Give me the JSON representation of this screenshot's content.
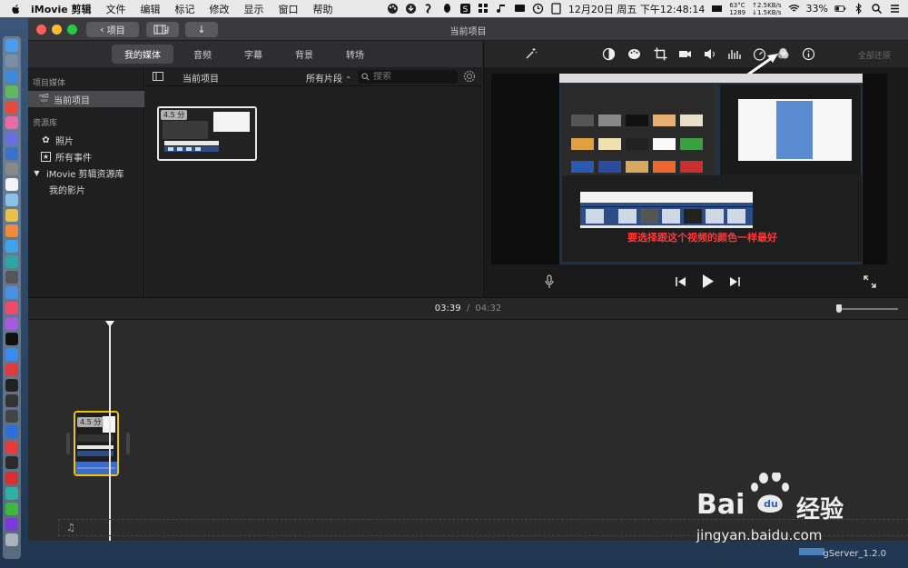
{
  "menubar": {
    "app_name": "iMovie 剪辑",
    "items": [
      "文件",
      "编辑",
      "标记",
      "修改",
      "显示",
      "窗口",
      "帮助"
    ],
    "temps": "63°C\n1289",
    "net_up": "↑2.5KB/s",
    "net_down": "↓1.5KB/s",
    "battery": "33%",
    "clock": "12月20日 周五 下午12:48:14"
  },
  "window": {
    "title": "当前项目",
    "back_button": "项目"
  },
  "browser_tabs": [
    "我的媒体",
    "音频",
    "字幕",
    "背景",
    "转场"
  ],
  "sidebar": {
    "section_project": "项目媒体",
    "current_project": "当前项目",
    "section_library": "资源库",
    "photos": "照片",
    "all_events": "所有事件",
    "library": "iMovie 剪辑资源库",
    "my_movies": "我的影片"
  },
  "browser": {
    "title": "当前项目",
    "filter": "所有片段",
    "search_placeholder": "搜索",
    "clip_duration": "4.5 分"
  },
  "viewer": {
    "reset_all": "全部还原",
    "caption": "要选择跟这个视频的颜色一样最好"
  },
  "timeline": {
    "current_time": "03:39",
    "separator": "/",
    "total_time": "04:32",
    "clip_duration": "4.5 分"
  },
  "watermark": {
    "brand": "Bai",
    "brand2": "经验",
    "url": "jingyan.baidu.com",
    "gserver": "gServer_1.2.0"
  },
  "colors": {
    "accent_yellow": "#f0c400",
    "caption_red": "#ff3838",
    "selected_bg": "#4a4a4c"
  }
}
